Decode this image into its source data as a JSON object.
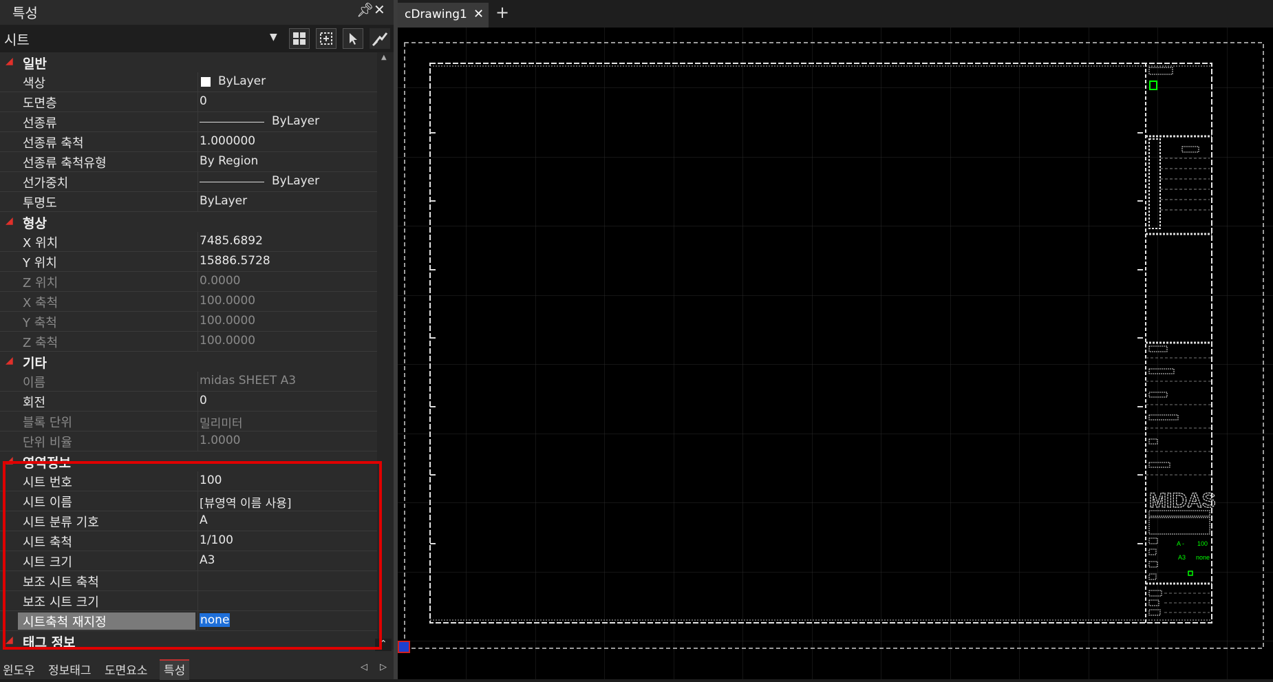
{
  "panel": {
    "title": "특성",
    "selector_value": "시트",
    "pin_icon": "pin-icon",
    "close_icon": "close-icon"
  },
  "categories": {
    "general": "일반",
    "geometry": "형상",
    "misc": "기타",
    "area": "영역정보",
    "tag": "태그 정보"
  },
  "general": {
    "color": {
      "k": "색상",
      "v": "ByLayer"
    },
    "layer": {
      "k": "도면층",
      "v": "0"
    },
    "linetype": {
      "k": "선종류",
      "v": "ByLayer"
    },
    "linetype_scale": {
      "k": "선종류 축척",
      "v": "1.000000"
    },
    "linetype_scale_type": {
      "k": "선종류 축척유형",
      "v": "By Region"
    },
    "lineweight": {
      "k": "선가중치",
      "v": "ByLayer"
    },
    "transparency": {
      "k": "투명도",
      "v": "ByLayer"
    }
  },
  "geometry": {
    "x_pos": {
      "k": "X 위치",
      "v": "7485.6892"
    },
    "y_pos": {
      "k": "Y 위치",
      "v": "15886.5728"
    },
    "z_pos": {
      "k": "Z 위치",
      "v": "0.0000"
    },
    "x_scale": {
      "k": "X 축척",
      "v": "100.0000"
    },
    "y_scale": {
      "k": "Y 축척",
      "v": "100.0000"
    },
    "z_scale": {
      "k": "Z 축척",
      "v": "100.0000"
    }
  },
  "misc": {
    "name": {
      "k": "이름",
      "v": "midas SHEET A3"
    },
    "rotation": {
      "k": "회전",
      "v": "0"
    },
    "block_unit": {
      "k": "블록 단위",
      "v": "밀리미터"
    },
    "unit_ratio": {
      "k": "단위 비율",
      "v": "1.0000"
    }
  },
  "area": {
    "sheet_no": {
      "k": "시트 번호",
      "v": "100"
    },
    "sheet_name": {
      "k": "시트 이름",
      "v": "[뷰영역 이름 사용]"
    },
    "sheet_class": {
      "k": "시트 분류 기호",
      "v": "A"
    },
    "sheet_scale": {
      "k": "시트 축척",
      "v": "1/100"
    },
    "sheet_size": {
      "k": "시트 크기",
      "v": "A3"
    },
    "sub_scale": {
      "k": "보조 시트 축척",
      "v": ""
    },
    "sub_size": {
      "k": "보조 시트 크기",
      "v": ""
    },
    "rescale": {
      "k": "시트축척 재지정",
      "v": "none"
    }
  },
  "bottom_tabs": [
    "윈도우",
    "정보태그",
    "도면요소",
    "특성"
  ],
  "doc_tab": {
    "label": "cDrawing1"
  },
  "titleblock": {
    "logo": "MIDAS",
    "cell1": "A -",
    "cell2": "100",
    "cell3": "A3",
    "cell4": "none"
  },
  "colors": {
    "accent_red": "#e00000",
    "selection_blue": "#1e6fd9",
    "cad_green": "#00ff00"
  }
}
